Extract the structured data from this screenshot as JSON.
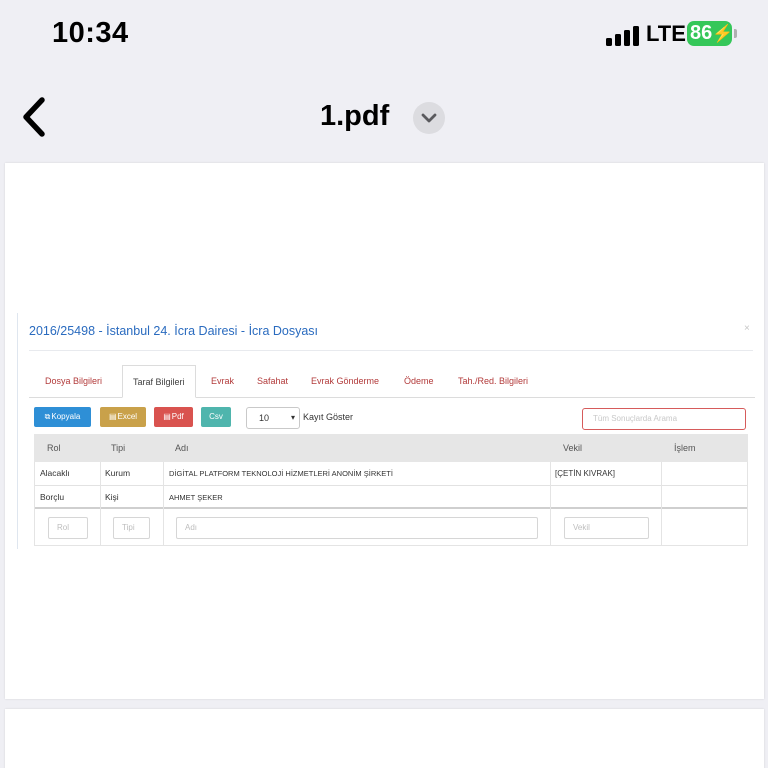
{
  "status_bar": {
    "time": "10:34",
    "network": "LTE",
    "battery": "86"
  },
  "nav": {
    "title": "1.pdf"
  },
  "document": {
    "close": "×",
    "title": "2016/25498 - İstanbul 24. İcra Dairesi - İcra Dosyası",
    "tabs": [
      {
        "label": "Dosya Bilgileri",
        "active": false
      },
      {
        "label": "Taraf Bilgileri",
        "active": true
      },
      {
        "label": "Evrak",
        "active": false
      },
      {
        "label": "Safahat",
        "active": false
      },
      {
        "label": "Evrak Gönderme",
        "active": false
      },
      {
        "label": "Ödeme",
        "active": false
      },
      {
        "label": "Tah./Red. Bilgileri",
        "active": false
      }
    ],
    "buttons": [
      {
        "label": "Kopyala",
        "color": "#2e8fd6"
      },
      {
        "label": "Excel",
        "color": "#c9a14a"
      },
      {
        "label": "Pdf",
        "color": "#d9534f"
      },
      {
        "label": "Csv",
        "color": "#4fb5ad"
      }
    ],
    "page_size": "10",
    "page_size_label": "Kayıt Göster",
    "search_placeholder": "Tüm Sonuçlarda Arama",
    "table": {
      "columns": [
        "Rol",
        "Tipi",
        "Adı",
        "Vekil",
        "İşlem"
      ],
      "rows": [
        {
          "rol": "Alacaklı",
          "tipi": "Kurum",
          "adi": "DİGİTAL PLATFORM TEKNOLOJİ HİZMETLERİ ANONİM ŞİRKETİ",
          "vekil": "[ÇETİN KIVRAK]",
          "islem": ""
        },
        {
          "rol": "Borçlu",
          "tipi": "Kişi",
          "adi": "AHMET ŞEKER",
          "vekil": "",
          "islem": ""
        }
      ],
      "filters": {
        "rol": "Rol",
        "tipi": "Tipi",
        "adi": "Adı",
        "vekil": "Vekil"
      }
    }
  }
}
